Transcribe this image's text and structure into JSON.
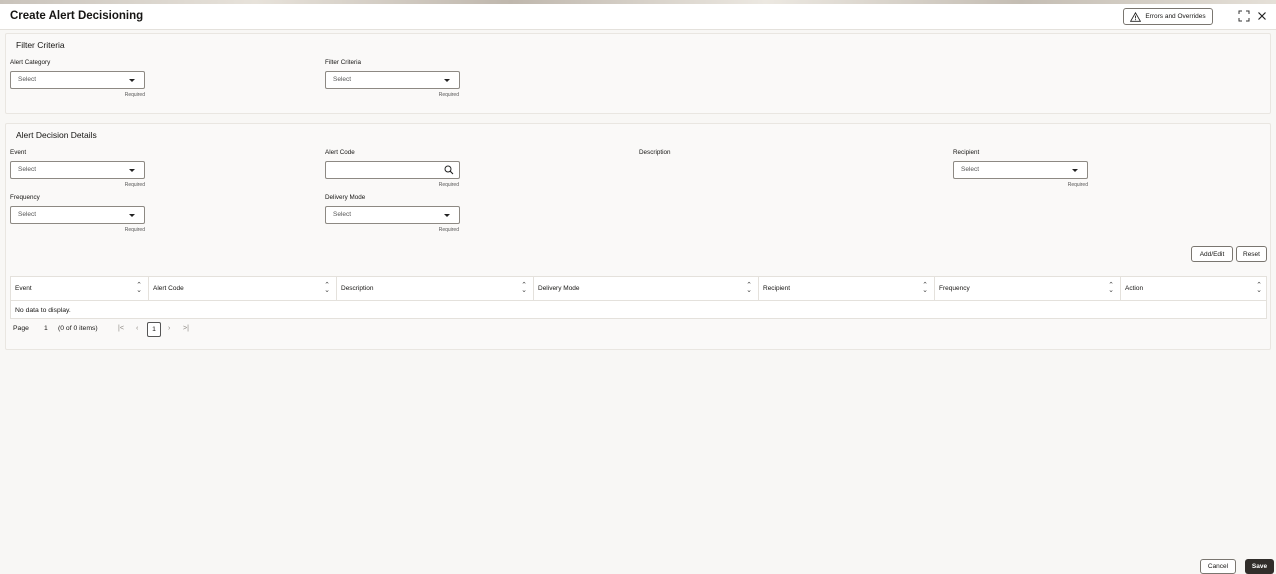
{
  "header": {
    "title": "Create Alert Decisioning",
    "errors_button": "Errors and Overrides"
  },
  "filter": {
    "section_title": "Filter Criteria",
    "alert_category": {
      "label": "Alert Category",
      "value": "Select",
      "hint": "Required"
    },
    "filter_criteria": {
      "label": "Filter Criteria",
      "value": "Select",
      "hint": "Required"
    }
  },
  "details": {
    "section_title": "Alert Decision Details",
    "event": {
      "label": "Event",
      "value": "Select",
      "hint": "Required"
    },
    "alert_code": {
      "label": "Alert Code",
      "value": "",
      "hint": "Required"
    },
    "description": {
      "label": "Description"
    },
    "recipient": {
      "label": "Recipient",
      "value": "Select",
      "hint": "Required"
    },
    "frequency": {
      "label": "Frequency",
      "value": "Select",
      "hint": "Required"
    },
    "delivery_mode": {
      "label": "Delivery Mode",
      "value": "Select",
      "hint": "Required"
    },
    "add_edit_button": "Add/Edit",
    "reset_button": "Reset"
  },
  "grid": {
    "columns": [
      "Event",
      "Alert Code",
      "Description",
      "Delivery Mode",
      "Recipient",
      "Frequency",
      "Action"
    ],
    "empty_message": "No data to display."
  },
  "pager": {
    "page_label": "Page",
    "page_number": "1",
    "items_info": "(0 of 0 items)",
    "current_page": "1"
  },
  "footer": {
    "cancel": "Cancel",
    "save": "Save"
  },
  "colors": {
    "save_bg": "#312d2a",
    "accent_border": "#7a7670"
  }
}
